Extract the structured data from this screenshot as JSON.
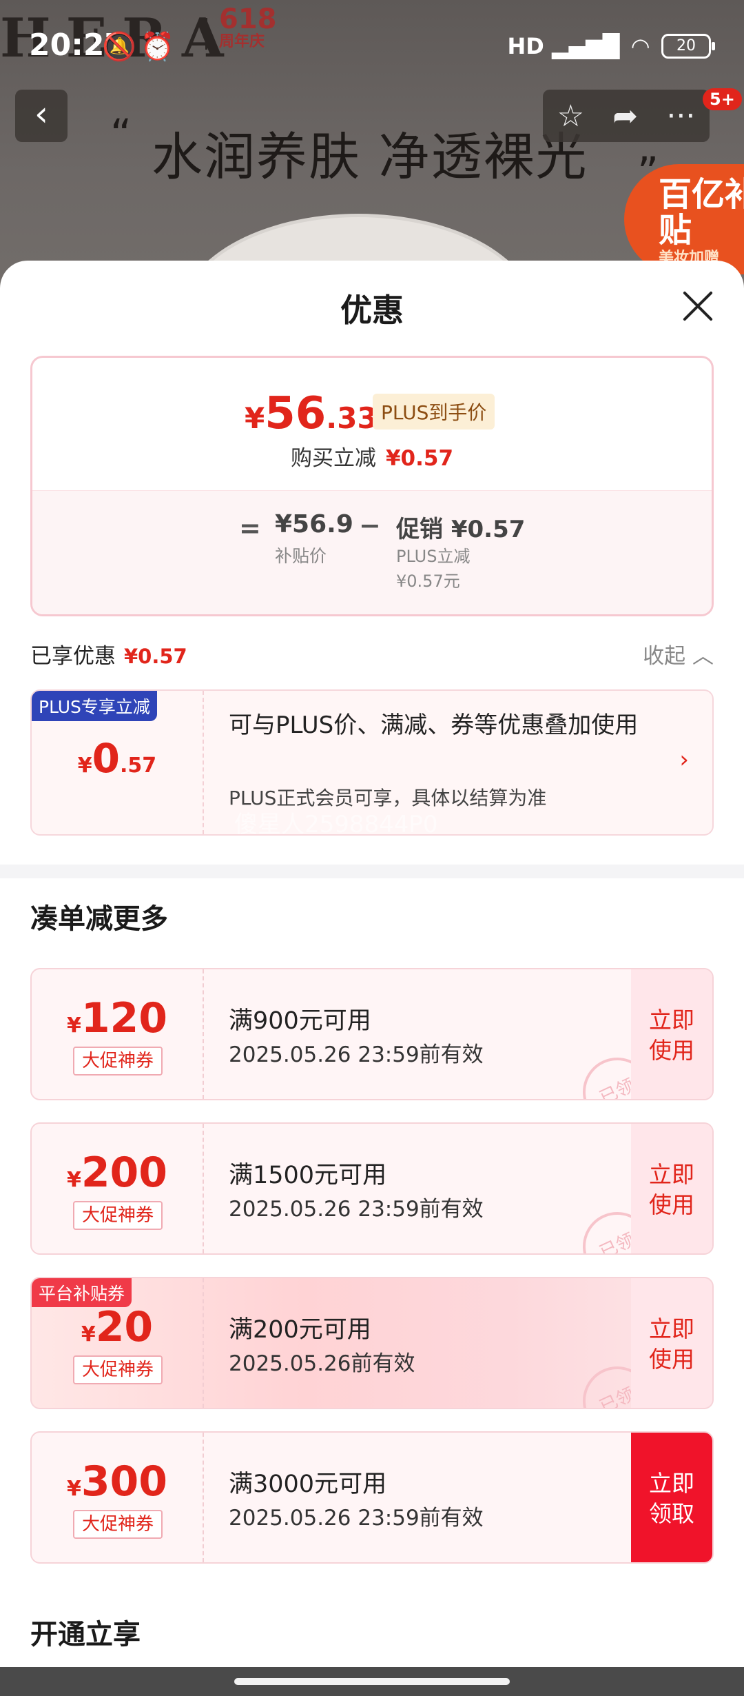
{
  "background": {
    "brand": "HERA",
    "anniversary_num": "618",
    "anniversary_text": "周年庆",
    "slogan": "水润养肤 净透裸光",
    "quote_left": "“",
    "quote_right": "”",
    "subsidy_title": "百亿补贴",
    "subsidy_sub": "美妆加赠"
  },
  "status_bar": {
    "time": "20:27",
    "signal_label": "HD",
    "battery": "20",
    "icons": [
      "bell-off-icon",
      "alarm-icon",
      "signal-icon",
      "wifi-icon",
      "battery-icon"
    ]
  },
  "nav": {
    "back": "‹",
    "star": "☆",
    "share": "➦",
    "more": "···",
    "badge": "5+"
  },
  "sheet": {
    "title": "优惠"
  },
  "price_card": {
    "yen": "¥",
    "price_int": "56",
    "price_dec": ".33",
    "plus_tag": "PLUS到手价",
    "buy_reduce_label": "购买立减",
    "buy_reduce_value": "¥0.57",
    "equals": "=",
    "base_price": "¥56.9",
    "base_label": "补贴价",
    "minus": "−",
    "promo_title": "促销 ¥0.57",
    "promo_line1": "PLUS立减",
    "promo_line2": "¥0.57元"
  },
  "enjoyed": {
    "label": "已享优惠",
    "amount": "¥0.57",
    "collapse": "收起"
  },
  "plus_coupon": {
    "label": "PLUS专享立减",
    "yen": "¥",
    "int": "0",
    "dec": ".57",
    "desc": "可与PLUS价、满减、券等优惠叠加使用",
    "sub": "PLUS正式会员可享，具体以结算为准",
    "watermark": "傻星人2598844P0"
  },
  "section_more": {
    "title": "凑单减更多"
  },
  "coupons": [
    {
      "yen": "¥",
      "value": "120",
      "tag": "大促神券",
      "condition": "满900元可用",
      "expiry": "2025.05.26 23:59前有效",
      "action": "立即使用",
      "stamp": "已领"
    },
    {
      "yen": "¥",
      "value": "200",
      "tag": "大促神券",
      "condition": "满1500元可用",
      "expiry": "2025.05.26 23:59前有效",
      "action": "立即使用",
      "stamp": "已领"
    },
    {
      "yen": "¥",
      "value": "20",
      "tag": "大促神券",
      "platform_label": "平台补贴券",
      "condition": "满200元可用",
      "expiry": "2025.05.26前有效",
      "action": "立即使用",
      "stamp": "已领"
    },
    {
      "yen": "¥",
      "value": "300",
      "tag": "大促神券",
      "condition": "满3000元可用",
      "expiry": "2025.05.26 23:59前有效",
      "action": "立即领取"
    }
  ],
  "section_open": {
    "title": "开通立享"
  },
  "colors": {
    "accent_red": "#e1251b",
    "plus_blue": "#2f44b8",
    "plus_gold": "#8c4d12"
  }
}
